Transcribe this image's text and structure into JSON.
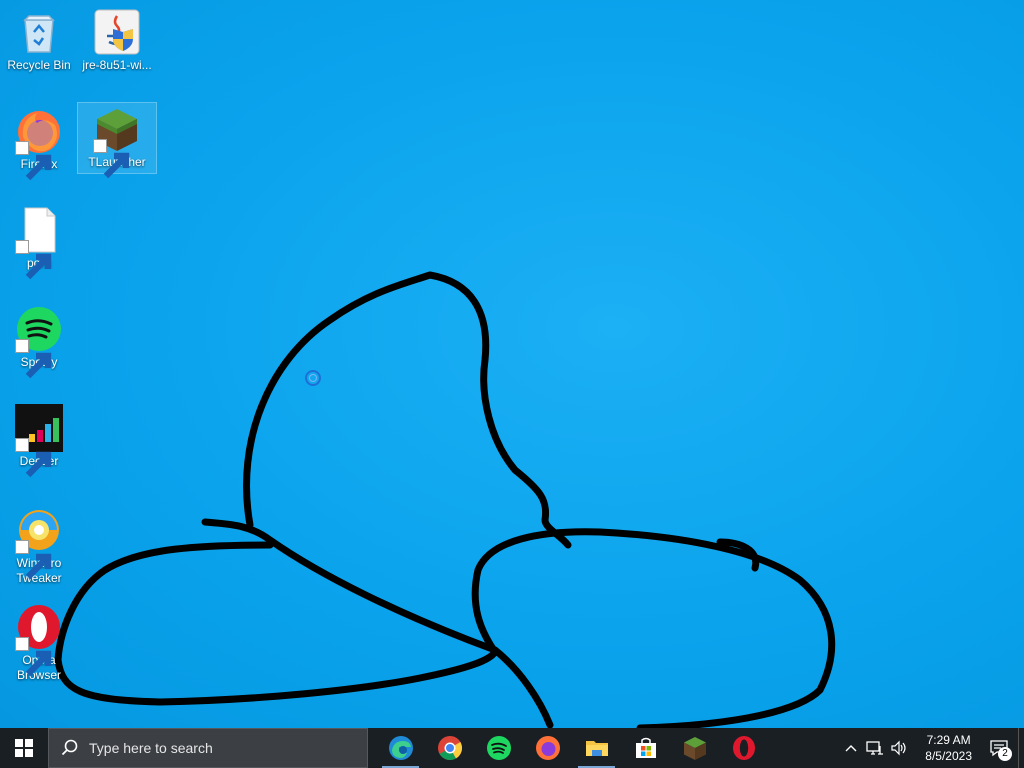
{
  "desktop": {
    "icons": [
      {
        "label": "Recycle Bin",
        "icon": "recycle-bin-icon",
        "shortcut": false
      },
      {
        "label": "jre-8u51-wi...",
        "icon": "java-installer-icon",
        "shortcut": false
      },
      {
        "label": "Firefox",
        "icon": "firefox-icon",
        "shortcut": true
      },
      {
        "label": "TLauncher",
        "icon": "tlauncher-icon",
        "shortcut": true
      },
      {
        "label": "porn",
        "icon": "blank-file-icon",
        "shortcut": true
      },
      {
        "label": "Spotify",
        "icon": "spotify-icon",
        "shortcut": true
      },
      {
        "label": "Deezer",
        "icon": "deezer-icon",
        "shortcut": true
      },
      {
        "label": "Winaero Tweaker",
        "icon": "winaero-tweaker-icon",
        "shortcut": true
      },
      {
        "label": "Opera Browser",
        "icon": "opera-icon",
        "shortcut": true
      }
    ],
    "wallpaper_color": "#0ba3ec"
  },
  "taskbar": {
    "search_placeholder": "Type here to search",
    "apps": [
      {
        "name": "Microsoft Edge",
        "icon": "edge-icon"
      },
      {
        "name": "Google Chrome",
        "icon": "chrome-icon"
      },
      {
        "name": "Spotify",
        "icon": "spotify-icon"
      },
      {
        "name": "Firefox",
        "icon": "firefox-icon"
      },
      {
        "name": "File Explorer",
        "icon": "folder-icon"
      },
      {
        "name": "Microsoft Store",
        "icon": "store-icon"
      },
      {
        "name": "TLauncher",
        "icon": "tlauncher-icon"
      },
      {
        "name": "Opera",
        "icon": "opera-icon"
      }
    ],
    "tray": {
      "time": "7:29 AM",
      "date": "8/5/2023",
      "notification_count": "2"
    }
  }
}
